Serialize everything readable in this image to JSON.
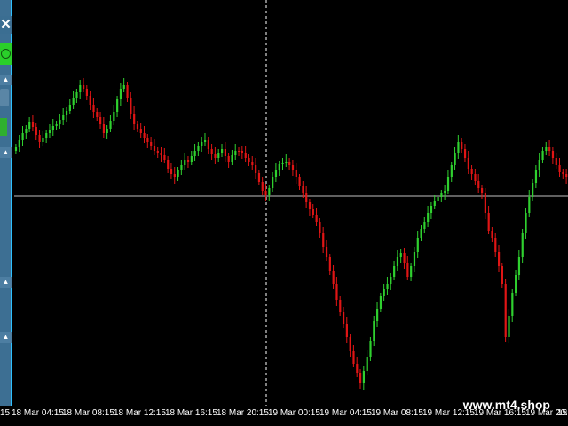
{
  "side_panel": {
    "close_label": "✕",
    "arrows": [
      "▲",
      "▲",
      "▲",
      "▲",
      "▲"
    ]
  },
  "x_axis": {
    "ticks": [
      "18 Mar 04:15",
      "18 Mar 08:15",
      "18 Mar 12:15",
      "18 Mar 16:15",
      "18 Mar 20:15",
      "19 Mar 00:15",
      "19 Mar 04:15",
      "19 Mar 08:15",
      "19 Mar 12:15",
      "19 Mar 16:15",
      "19 Mar 20:15"
    ],
    "first_partial": "15",
    "last_partial": "15"
  },
  "watermark": "www.mt4.shop",
  "colors": {
    "bull": "#2fd02f",
    "bear": "#e01515",
    "crosshair": "#ffffff",
    "hline": "#c0c0c0"
  },
  "chart_data": {
    "type": "candlestick",
    "series_close": [
      166,
      158,
      150,
      145,
      138,
      143,
      152,
      160,
      156,
      150,
      146,
      142,
      140,
      135,
      130,
      125,
      118,
      110,
      104,
      96,
      100,
      108,
      118,
      126,
      132,
      140,
      150,
      145,
      136,
      126,
      112,
      100,
      96,
      110,
      128,
      140,
      145,
      150,
      155,
      160,
      165,
      170,
      172,
      175,
      180,
      190,
      196,
      200,
      192,
      186,
      180,
      182,
      176,
      170,
      164,
      160,
      158,
      168,
      174,
      178,
      172,
      168,
      176,
      182,
      175,
      170,
      170,
      172,
      178,
      182,
      186,
      195,
      205,
      215,
      220,
      212,
      200,
      192,
      185,
      184,
      182,
      186,
      192,
      200,
      210,
      218,
      228,
      236,
      242,
      250,
      262,
      278,
      290,
      305,
      320,
      338,
      352,
      365,
      380,
      395,
      410,
      420,
      432,
      418,
      402,
      384,
      362,
      348,
      334,
      326,
      320,
      312,
      300,
      290,
      285,
      296,
      312,
      300,
      284,
      268,
      258,
      250,
      240,
      232,
      226,
      222,
      218,
      215,
      200,
      186,
      172,
      160,
      168,
      178,
      190,
      196,
      204,
      212,
      218,
      240,
      260,
      268,
      284,
      300,
      320,
      380,
      356,
      330,
      310,
      290,
      262,
      240,
      222,
      206,
      192,
      180,
      170,
      166,
      170,
      178,
      186,
      194,
      196,
      200
    ]
  }
}
